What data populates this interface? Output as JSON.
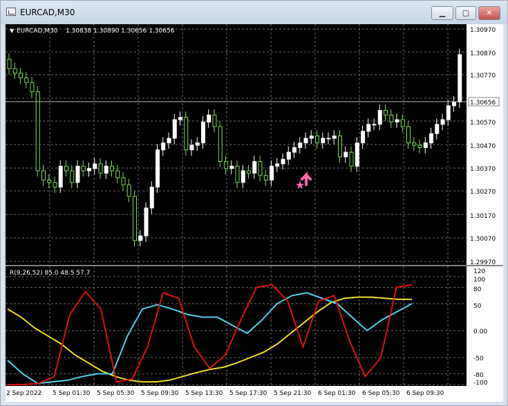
{
  "window": {
    "title": "EURCAD,M30",
    "buttons": {
      "minimize": "▁",
      "maximize": "▢",
      "close": "✕"
    }
  },
  "main_chart": {
    "header_marker": "▼",
    "symbol": "EURCAD,M30",
    "ohlc": "1.30838 1.30890 1.30656 1.30656",
    "price_ticks": [
      "1.30970",
      "1.30870",
      "1.30770",
      "1.30656",
      "1.30570",
      "1.30470",
      "1.30370",
      "1.30270",
      "1.30170",
      "1.30070",
      "1.29970"
    ],
    "current_price": "1.30656"
  },
  "indicator": {
    "label": "R(9,26,52) 85.0 48.5 57.7",
    "ticks": [
      "120",
      "100",
      "80",
      "50",
      "0.00",
      "-50",
      "-80",
      "-100"
    ]
  },
  "time_axis": {
    "labels": [
      "2 Sep 2022",
      "5 Sep 01:30",
      "5 Sep 05:30",
      "5 Sep 09:30",
      "5 Sep 13:30",
      "5 Sep 17:30",
      "5 Sep 21:30",
      "6 Sep 01:30",
      "6 Sep 05:30",
      "6 Sep 09:30"
    ]
  },
  "colors": {
    "background": "#000000",
    "bull": "#ffffff",
    "bear": "#7cdc5a",
    "grid": "#6b6b6b",
    "red_line": "#e01010",
    "cyan_line": "#4fd3ea",
    "yellow_line": "#f0e020",
    "arrow": "#ff6ab0"
  },
  "chart_data": {
    "type": "line",
    "series": [
      {
        "values": [
          40,
          25,
          5,
          -10,
          -25,
          -45,
          -60,
          -75,
          -85,
          -92,
          -95,
          -95,
          -92,
          -85,
          -78,
          -72,
          -68,
          -60,
          -50,
          -40,
          -25,
          -5,
          15,
          35,
          52,
          60,
          62,
          62,
          60,
          58,
          58
        ]
      },
      {
        "values": [
          -55,
          -80,
          -98,
          -95,
          -92,
          -85,
          -80,
          -80,
          -10,
          40,
          48,
          40,
          30,
          25,
          25,
          10,
          -5,
          20,
          50,
          65,
          70,
          60,
          50,
          25,
          0,
          20,
          35,
          50
        ]
      },
      {
        "values": [
          -100,
          -100,
          -98,
          -85,
          30,
          72,
          40,
          -95,
          -90,
          -30,
          70,
          60,
          -30,
          -70,
          -45,
          20,
          80,
          85,
          55,
          -30,
          55,
          65,
          -20,
          -85,
          -50,
          80,
          85
        ]
      }
    ],
    "ylim": [
      -100,
      120
    ]
  }
}
